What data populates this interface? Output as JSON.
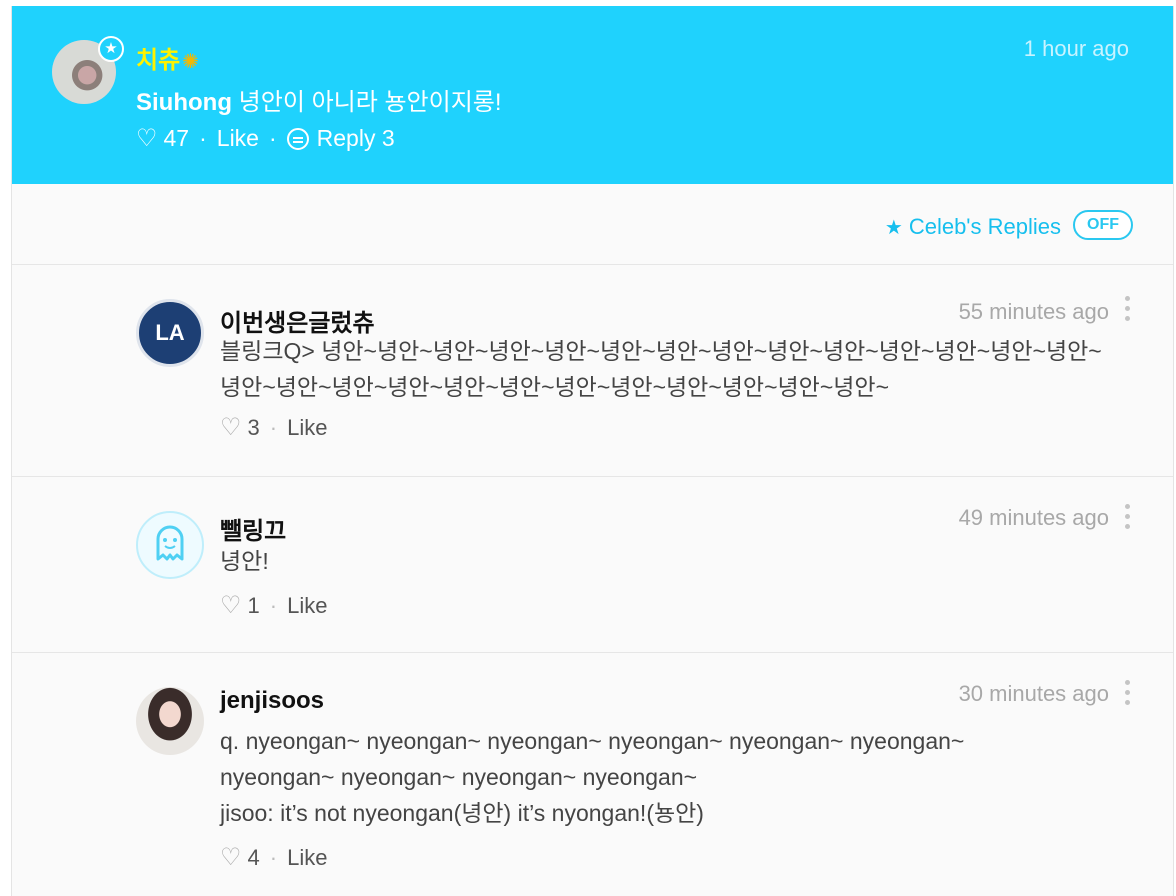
{
  "post": {
    "author": "치츄",
    "author_icon": "sunflower-icon",
    "time": "1 hour ago",
    "mention": "Siuhong",
    "text": "녕안이 아니라 뇽안이지롱!",
    "likes": "47",
    "like_label": "Like",
    "reply_label": "Reply 3",
    "accent_color": "#1fd2fd"
  },
  "filter": {
    "label": "Celeb's Replies",
    "toggle": "OFF"
  },
  "comments": [
    {
      "name": "이번생은글렀츄",
      "time": "55 minutes ago",
      "text": "블링크Q> 녕안~녕안~녕안~녕안~녕안~녕안~녕안~녕안~녕안~녕안~녕안~녕안~녕안~녕안~녕안~녕안~녕안~녕안~녕안~녕안~녕안~녕안~녕안~녕안~녕안~녕안~",
      "likes": "3",
      "like_label": "Like",
      "avatar_text": "LA"
    },
    {
      "name": "뺄링끄",
      "time": "49 minutes ago",
      "text": "녕안!",
      "likes": "1",
      "like_label": "Like"
    },
    {
      "name": "jenjisoos",
      "time": "30 minutes ago",
      "text": "q. nyeongan~ nyeongan~ nyeongan~ nyeongan~ nyeongan~ nyeongan~ nyeongan~ nyeongan~ nyeongan~ nyeongan~",
      "text2": "jisoo: it’s not nyeongan(녕안) it’s nyongan!(뇽안)",
      "likes": "4",
      "like_label": "Like"
    }
  ]
}
